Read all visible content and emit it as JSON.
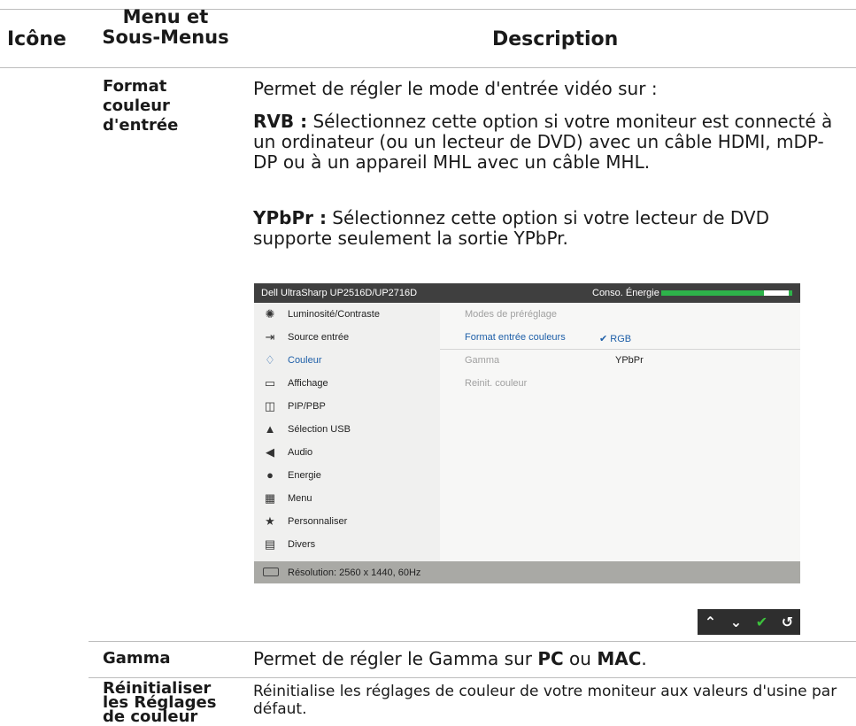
{
  "header": {
    "icon": "Icône",
    "menu_line1": "Menu et",
    "menu_line2": "Sous-Menus",
    "description": "Description"
  },
  "rows": {
    "format": {
      "label": [
        "Format",
        "couleur",
        "d'entrée"
      ],
      "intro": "Permet de régler le mode d'entrée vidéo sur :",
      "rgb_term": "RVB :",
      "rgb_text": " Sélectionnez cette option si votre moniteur est connecté à un ordinateur (ou un lecteur de DVD) avec un câble HDMI, mDP-DP ou à un appareil MHL avec un câble MHL.",
      "ypbpr_term": "YPbPr :",
      "ypbpr_text": " Sélectionnez cette option si votre lecteur de DVD supporte seulement la sortie YPbPr."
    },
    "gamma": {
      "label": "Gamma",
      "text_before": "Permet de régler le Gamma sur ",
      "pc": "PC",
      "or": " ou ",
      "mac": "MAC",
      "period": "."
    },
    "reset": {
      "label": [
        "Réinitialiser",
        "les Réglages",
        "de couleur"
      ],
      "text": "Réinitialise les réglages de couleur de votre moniteur aux valeurs d'usine par défaut."
    }
  },
  "osd": {
    "model": "Dell UltraSharp UP2516D/UP2716D",
    "energy_label": "Conso. Énergie",
    "energy_level": 0.8,
    "menu": [
      {
        "label": "Luminosité/Contraste",
        "icon": "brightness-icon"
      },
      {
        "label": "Source entrée",
        "icon": "input-source-icon"
      },
      {
        "label": "Couleur",
        "icon": "color-icon",
        "active": true
      },
      {
        "label": "Affichage",
        "icon": "display-icon"
      },
      {
        "label": "PIP/PBP",
        "icon": "pip-icon"
      },
      {
        "label": "Sélection USB",
        "icon": "usb-icon"
      },
      {
        "label": "Audio",
        "icon": "audio-icon"
      },
      {
        "label": "Energie",
        "icon": "energy-icon"
      },
      {
        "label": "Menu",
        "icon": "menu-icon"
      },
      {
        "label": "Personnaliser",
        "icon": "star-icon"
      },
      {
        "label": "Divers",
        "icon": "others-icon"
      }
    ],
    "submenu": [
      "Modes de préréglage",
      "Format entrée couleurs",
      "Gamma",
      "Reinit. couleur"
    ],
    "options": {
      "rgb": "RGB",
      "ypbpr": "YPbPr"
    },
    "status": "Résolution: 2560 x 1440, 60Hz",
    "accent": "#1e5fa8",
    "energy_color": "#2db34a"
  },
  "nav_buttons": [
    "up-icon",
    "down-icon",
    "check-icon",
    "back-icon"
  ]
}
